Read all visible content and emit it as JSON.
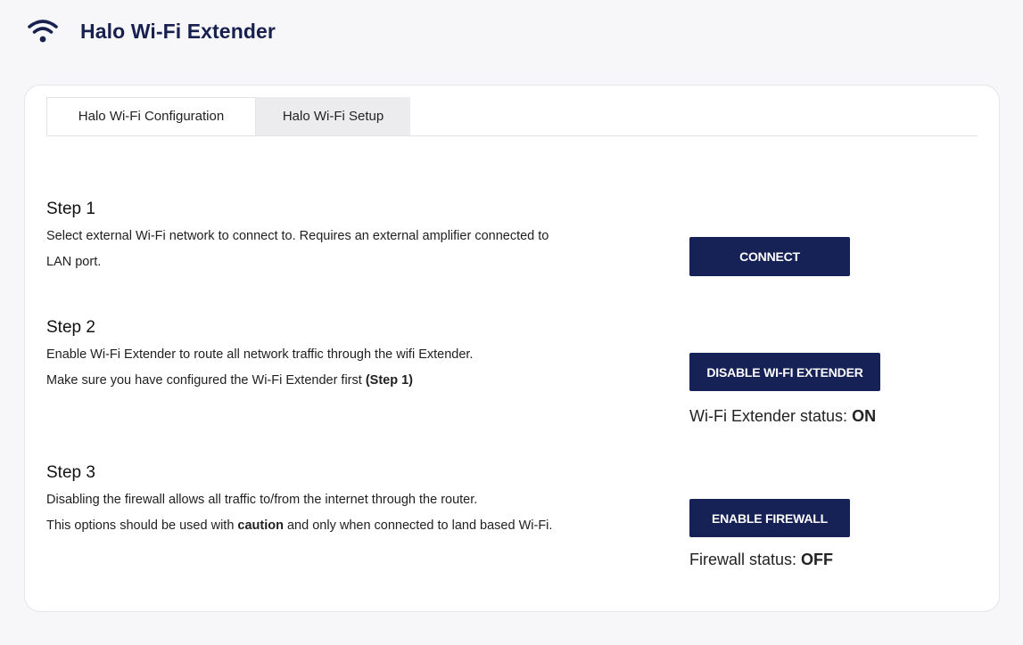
{
  "app": {
    "title": "Halo Wi-Fi Extender",
    "icon": "wifi-icon",
    "accent_color": "#162256"
  },
  "tabs": [
    {
      "label": "Halo Wi-Fi Configuration",
      "active": true
    },
    {
      "label": "Halo Wi-Fi Setup",
      "active": false
    }
  ],
  "steps": [
    {
      "title": "Step 1",
      "lines": [
        "Select external Wi-Fi network to connect to. Requires an external amplifier connected to",
        "LAN port."
      ],
      "button": "CONNECT"
    },
    {
      "title": "Step 2",
      "line1": "Enable Wi-Fi Extender to route all network traffic through the wifi Extender.",
      "line2_prefix": "Make sure you have configured the Wi-Fi Extender first ",
      "line2_bold": "(Step 1)",
      "button": "DISABLE WI-FI EXTENDER",
      "status_label": "Wi-Fi Extender status: ",
      "status_value": "ON"
    },
    {
      "title": "Step 3",
      "line1": "Disabling the firewall allows all traffic to/from the internet through the router.",
      "line2_prefix": "This options should be used with ",
      "line2_bold": "caution",
      "line2_suffix": " and only when connected to land based Wi-Fi.",
      "button": "ENABLE FIREWALL",
      "status_label": "Firewall status: ",
      "status_value": "OFF"
    }
  ]
}
